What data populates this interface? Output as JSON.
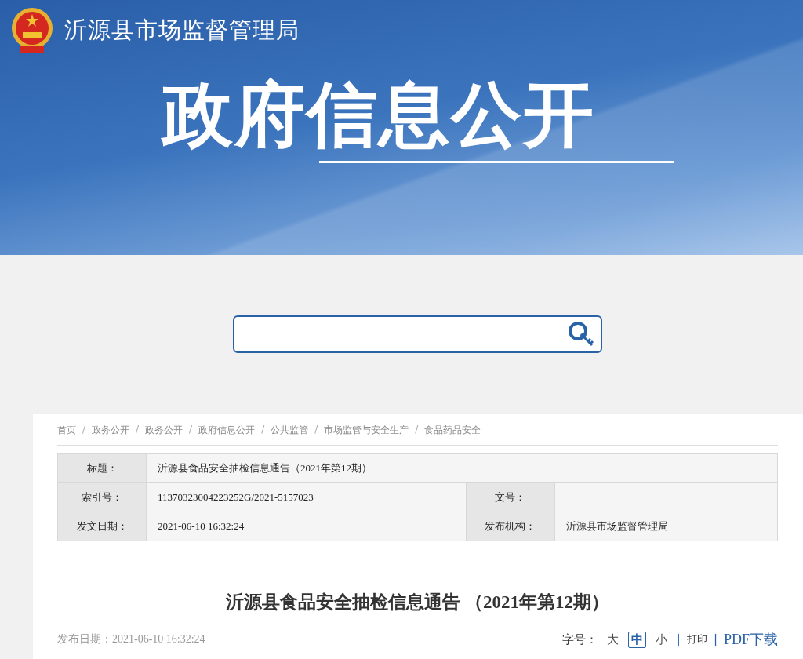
{
  "header": {
    "site_name": "沂源县市场监督管理局",
    "banner_title": "政府信息公开"
  },
  "breadcrumb": [
    {
      "text": "首页"
    },
    {
      "separator": "/",
      "text": "政务公开"
    },
    {
      "separator": "/",
      "text": "政务公开"
    },
    {
      "separator": "/",
      "text": "政府信息公开"
    },
    {
      "separator": "/",
      "text": "公共监管"
    },
    {
      "separator": "/",
      "text": "市场监管与安全生产"
    },
    {
      "separator": "/",
      "text": "食品药品安全"
    }
  ],
  "info_table": {
    "rows": [
      [
        {
          "label": "标题：",
          "value": "沂源县食品安全抽检信息通告（2021年第12期）"
        }
      ],
      [
        {
          "label": "索引号：",
          "value": "11370323004223252G/2021-5157023"
        },
        {
          "label": "文号："
        }
      ],
      [
        {
          "label": "发文日期：",
          "value": "2021-06-10 16:32:24"
        },
        {
          "label": "发布机构：",
          "value": "沂源县市场监督管理局"
        }
      ]
    ]
  },
  "article": {
    "title": "沂源县食品安全抽检信息通告 （2021年第12期）",
    "date": "发布日期：2021-06-10 16:32:24",
    "font_size_label": "字号：",
    "font_sizes": [
      {
        "label": "大",
        "selected": false
      },
      {
        "label": "中",
        "selected": true
      },
      {
        "label": "小",
        "selected": false
      }
    ],
    "separators": [
      "|",
      "|"
    ],
    "print": "打印",
    "pdf": "PDF下载"
  }
}
